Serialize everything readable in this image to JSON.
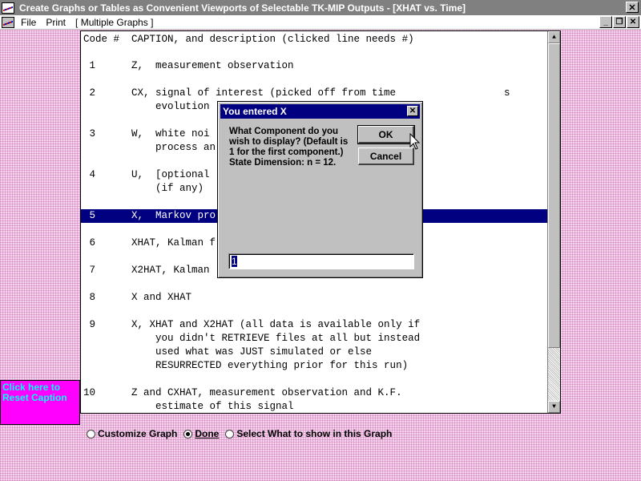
{
  "window": {
    "title": "Create Graphs or Tables as Convenient Viewports of Selectable TK-MIP Outputs - [XHAT vs. Time]",
    "close_glyph": "✕",
    "icon": "chart-window-icon"
  },
  "menu": {
    "file": "File",
    "print": "Print",
    "multiple_graphs": "[ Multiple Graphs ]",
    "mdi_minimize": "_",
    "mdi_restore": "❐",
    "mdi_close": "✕"
  },
  "list": {
    "header": "Code #  CAPTION, and description (clicked line needs #)",
    "lines": [
      " 1      Z,  measurement observation",
      " 2      CX, signal of interest (picked off from time",
      "            evolution",
      " 3      W,  white noi",
      "            process an",
      " 4      U,  [optional",
      "            (if any)",
      " 5      X,  Markov pro",
      " 6      XHAT, Kalman f",
      " 7      X2HAT, Kalman",
      " 8      X and XHAT",
      " 9      X, XHAT and X2HAT (all data is available only if",
      "            you didn't RETRIEVE files at all but instead",
      "            used what was JUST simulated or else",
      "            RESURRECTED everything prior for this run)",
      "10      Z and CXHAT, measurement observation and K.F.",
      "            estimate of this signal"
    ],
    "overflow_fragment": "s"
  },
  "reset_caption": "Click here to Reset Caption",
  "radio": {
    "customize": "Customize Graph",
    "done": "Done",
    "select": "Select What to show in this Graph",
    "selected": "done"
  },
  "dialog": {
    "title": "You entered X",
    "close_glyph": "✕",
    "prompt": "What Component do you wish to display? (Default is 1 for the first component.) State Dimension: n = 12.",
    "ok": "OK",
    "cancel": "Cancel",
    "input_value": "1"
  },
  "colors": {
    "selection": "#000080",
    "reset_bg": "#ff00ff",
    "reset_text": "#00ffff",
    "title_inactive": "#808080"
  }
}
